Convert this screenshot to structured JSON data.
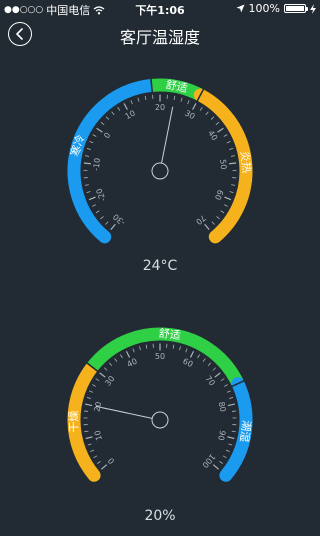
{
  "status": {
    "carrier": "中国电信",
    "time": "下午1:06",
    "battery": "100%"
  },
  "header": {
    "title": "客厅温湿度",
    "back_icon": "chevron-left-icon"
  },
  "temperature": {
    "reading": "24°C",
    "value": 24,
    "scale_min": -30,
    "scale_max": 70,
    "ticks": [
      "-30",
      "-20",
      "-10",
      "0",
      "10",
      "20",
      "30",
      "40",
      "50",
      "60",
      "70"
    ],
    "zones": [
      {
        "label": "寒冷",
        "from": -30,
        "to": 18,
        "color": "#1a9bf0"
      },
      {
        "label": "舒适",
        "from": 18,
        "to": 30,
        "color": "#2fcf46"
      },
      {
        "label": "炎热",
        "from": 30,
        "to": 70,
        "color": "#f5b21c"
      }
    ]
  },
  "humidity": {
    "reading": "20%",
    "value": 20,
    "scale_min": 0,
    "scale_max": 100,
    "ticks": [
      "0",
      "10",
      "20",
      "30",
      "40",
      "50",
      "60",
      "70",
      "80",
      "90",
      "100"
    ],
    "zones": [
      {
        "label": "干燥",
        "from": 0,
        "to": 30,
        "color": "#f5b21c"
      },
      {
        "label": "舒适",
        "from": 30,
        "to": 75,
        "color": "#2fcf46"
      },
      {
        "label": "潮湿",
        "from": 75,
        "to": 100,
        "color": "#1a9bf0"
      }
    ]
  }
}
